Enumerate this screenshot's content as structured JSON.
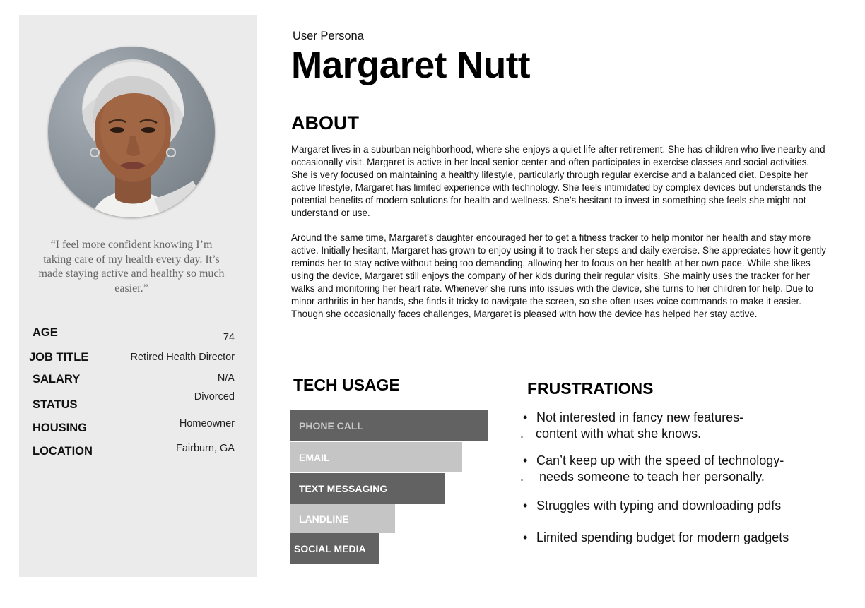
{
  "sidebar": {
    "quote": "“I feel more confident knowing I’m taking care of my health every day. It’s made staying active and healthy so much easier.”",
    "facts": [
      {
        "label": "AGE",
        "value": "74"
      },
      {
        "label": "JOB TITLE",
        "value": "Retired Health Director"
      },
      {
        "label": "SALARY",
        "value": "N/A"
      },
      {
        "label": "STATUS",
        "value": "Divorced"
      },
      {
        "label": "HOUSING",
        "value": "Homeowner"
      },
      {
        "label": "LOCATION",
        "value": "Fairburn, GA"
      }
    ]
  },
  "header": {
    "kicker": "User Persona",
    "name": "Margaret Nutt"
  },
  "about": {
    "heading": "ABOUT",
    "paragraphs": [
      "Margaret lives in a suburban neighborhood, where she enjoys a quiet life after retirement. She has children who live nearby and occasionally visit. Margaret is active in her local senior center and often participates in exercise classes and social activities. She is very focused on maintaining a healthy lifestyle, particularly through regular exercise and a balanced diet. Despite her active lifestyle, Margaret has limited experience with technology. She feels intimidated by complex devices but understands the potential benefits of modern solutions for health and wellness. She’s hesitant to invest in something she feels she might not understand or use.",
      "Around the same time, Margaret’s daughter encouraged her to get a fitness tracker to help monitor her health and stay more active. Initially hesitant, Margaret has grown to enjoy using it to track her steps and daily exercise. She appreciates how it gently reminds her to stay active without being too demanding, allowing her to focus on her health at her own pace. While she likes using the device, Margaret still enjoys the company of her kids during their regular visits. She mainly uses the tracker for her walks and monitoring her heart rate. Whenever she runs into issues with the device, she turns to her children for help. Due to minor arthritis in her hands, she finds it tricky to navigate the screen, so she often uses voice commands to make it easier. Though she occasionally faces challenges, Margaret is pleased with how the device has helped her stay active."
    ]
  },
  "tech_usage": {
    "heading": "TECH USAGE",
    "items": [
      {
        "label": "PHONE CALL",
        "level": 1.0,
        "tone": "dark",
        "label_color": "#c9c9c9"
      },
      {
        "label": "EMAIL",
        "level": 0.87,
        "tone": "light",
        "label_color": "#ffffff"
      },
      {
        "label": "TEXT MESSAGING",
        "level": 0.784,
        "tone": "dark",
        "label_color": "#ffffff"
      },
      {
        "label": "LANDLINE",
        "level": 0.532,
        "tone": "light",
        "label_color": "#ffffff"
      },
      {
        "label": "SOCIAL MEDIA",
        "level": 0.453,
        "tone": "dark",
        "label_color": "#ffffff"
      }
    ],
    "colors": {
      "dark": "#636262",
      "light": "#c5c5c5"
    }
  },
  "frustrations": {
    "heading": "FRUSTRATIONS",
    "items": [
      {
        "text": "Not interested in fancy new features-",
        "cont": "content with what she knows."
      },
      {
        "text": "Can’t keep up with the speed of technology-",
        "cont": "needs someone to teach her personally."
      },
      {
        "text": "Struggles with typing and downloading pdfs"
      },
      {
        "text": "Limited spending budget for modern gadgets"
      }
    ]
  }
}
